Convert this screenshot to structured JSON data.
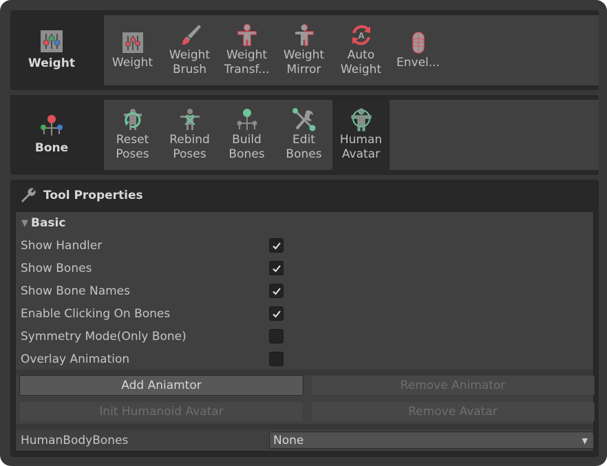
{
  "weight_group": {
    "label": "Weight",
    "icon": "weight-sliders-icon",
    "tools": [
      {
        "label": "Weight",
        "icon": "weight-sliders-icon",
        "selected": false
      },
      {
        "label": "Weight\nBrush",
        "icon": "paint-brush-icon",
        "selected": false
      },
      {
        "label": "Weight\nTransf...",
        "icon": "weight-transfer-figure-icon",
        "selected": false
      },
      {
        "label": "Weight\nMirror",
        "icon": "weight-mirror-figure-icon",
        "selected": false
      },
      {
        "label": "Auto\nWeight",
        "icon": "auto-weight-refresh-icon",
        "selected": false
      },
      {
        "label": "Envel...",
        "icon": "envelope-capsule-icon",
        "selected": false
      }
    ]
  },
  "bone_group": {
    "label": "Bone",
    "icon": "bone-hierarchy-icon",
    "tools": [
      {
        "label": "Reset\nPoses",
        "icon": "reset-poses-icon",
        "selected": false
      },
      {
        "label": "Rebind\nPoses",
        "icon": "rebind-poses-icon",
        "selected": false
      },
      {
        "label": "Build\nBones",
        "icon": "build-bones-icon",
        "selected": false
      },
      {
        "label": "Edit\nBones",
        "icon": "edit-bones-wrench-icon",
        "selected": false
      },
      {
        "label": "Human\nAvatar",
        "icon": "human-avatar-icon",
        "selected": true
      }
    ]
  },
  "tool_properties": {
    "title": "Tool Properties",
    "icon": "wrench-icon",
    "section": "Basic",
    "toggles": [
      {
        "label": "Show Handler",
        "checked": true
      },
      {
        "label": "Show Bones",
        "checked": true
      },
      {
        "label": "Show Bone Names",
        "checked": true
      },
      {
        "label": "Enable Clicking On Bones",
        "checked": true
      },
      {
        "label": "Symmetry Mode(Only Bone)",
        "checked": false
      },
      {
        "label": "Overlay Animation",
        "checked": false
      }
    ],
    "buttons": {
      "add_animator": "Add Aniamtor",
      "remove_animator": "Remove Animator",
      "init_avatar": "Init Humanoid Avatar",
      "remove_avatar": "Remove Avatar"
    },
    "human_body_bones": {
      "label": "HumanBodyBones",
      "value": "None"
    }
  },
  "colors": {
    "accent_red": "#e0505a",
    "accent_green": "#6fc49a",
    "accent_blue": "#3f7fcf"
  }
}
